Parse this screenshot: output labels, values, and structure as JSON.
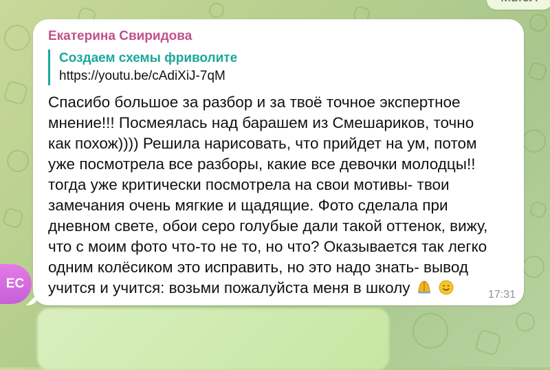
{
  "top_bubble_text": "мысл",
  "avatar_initials": "EC",
  "message": {
    "sender": "Екатерина Свиридова",
    "preview_title": "Создаем схемы фриволите",
    "preview_url": "https://youtu.be/cAdiXiJ-7qM",
    "lines": [
      "Спасибо большое за разбор и за твоё точное экспертное",
      "мнение!!! Посмеялась над барашем из Смешариков, точно",
      "как похож)))) Решила нарисовать, что прийдет на ум, потом",
      "уже посмотрела все разборы, какие все девочки молодцы!!",
      "тогда уже критически посмотрела на свои мотивы- твои",
      "замечания очень мягкие и щадящие. Фото сделала при",
      "дневном свете, обои серо голубые дали такой оттенок, вижу,",
      "что с моим фото что-то не то, но что? Оказывается так легко",
      "одним колёсиком это исправить, но это надо знать- вывод",
      "учится и учится: возьми пожалуйста меня в школу"
    ],
    "time": "17:31"
  }
}
